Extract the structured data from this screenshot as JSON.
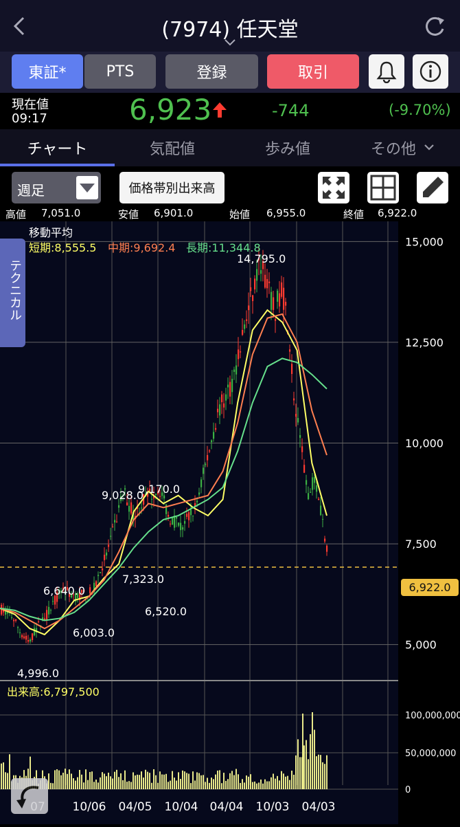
{
  "header": {
    "title": "(7974) 任天堂"
  },
  "buttons": {
    "tse": "東証*",
    "pts": "PTS",
    "register": "登録",
    "trade": "取引"
  },
  "price": {
    "label": "現在値",
    "time": "09:17",
    "value": "6,923",
    "change": "-744",
    "change_pct": "(-9.70%)"
  },
  "tabs": [
    {
      "label": "チャート"
    },
    {
      "label": "気配値"
    },
    {
      "label": "歩み値"
    },
    {
      "label": "その他"
    }
  ],
  "toolbar": {
    "period": "週足",
    "price_volume": "価格帯別出来高"
  },
  "ohlc": {
    "high_label": "高値",
    "high": "7,051.0",
    "low_label": "安値",
    "low": "6,901.0",
    "open_label": "始値",
    "open": "6,955.0",
    "close_label": "終値",
    "close": "6,922.0"
  },
  "technical_tab": "テクニカル",
  "ma": {
    "title": "移動平均",
    "short": "短期:8,555.5",
    "mid": "中期:9,692.4",
    "long": "長期:11,344.8"
  },
  "volume_label": "出来高:6,797,500",
  "colors": {
    "up": "#ff3b30",
    "down": "#3cb043",
    "short_ma": "#ffff66",
    "mid_ma": "#ff7f50",
    "long_ma": "#66e08c",
    "volume": "#e8e88a",
    "accent": "#5a6fe8"
  },
  "chart_data": {
    "type": "candlestick",
    "price_axis": {
      "ticks": [
        "15,000",
        "12,500",
        "10,000",
        "7,500",
        "5,000"
      ],
      "ylim": [
        4500,
        15500
      ]
    },
    "volume_axis": {
      "ticks": [
        "100,000,000",
        "50,000,000",
        "0"
      ]
    },
    "x_ticks": [
      "07",
      "10/06",
      "04/05",
      "10/04",
      "04/04",
      "10/03",
      "04/03"
    ],
    "current_price_marker": "6,922.0",
    "annotations": [
      "14,795.0",
      "9,028.0",
      "9,170.0",
      "7,323.0",
      "6,640.0",
      "6,003.0",
      "6,520.0",
      "4,996.0"
    ],
    "series": [
      {
        "name": "短期",
        "values": [
          5900,
          5750,
          5400,
          5250,
          5600,
          6100,
          6200,
          6650,
          7000,
          8300,
          8800,
          8500,
          8700,
          8400,
          8200,
          8600,
          11000,
          12800,
          13300,
          13000,
          12300,
          9500,
          8200
        ]
      },
      {
        "name": "中期",
        "values": [
          5900,
          5800,
          5600,
          5400,
          5600,
          5900,
          6200,
          6600,
          7300,
          8100,
          8500,
          8400,
          8500,
          8600,
          8700,
          9300,
          10500,
          12200,
          13100,
          13200,
          12500,
          10800,
          9700
        ]
      },
      {
        "name": "長期",
        "values": [
          5900,
          5850,
          5700,
          5600,
          5650,
          5800,
          6100,
          6500,
          6900,
          7400,
          7800,
          8100,
          8200,
          8400,
          8600,
          8900,
          9800,
          11000,
          11900,
          12100,
          12000,
          11700,
          11345
        ]
      }
    ]
  }
}
